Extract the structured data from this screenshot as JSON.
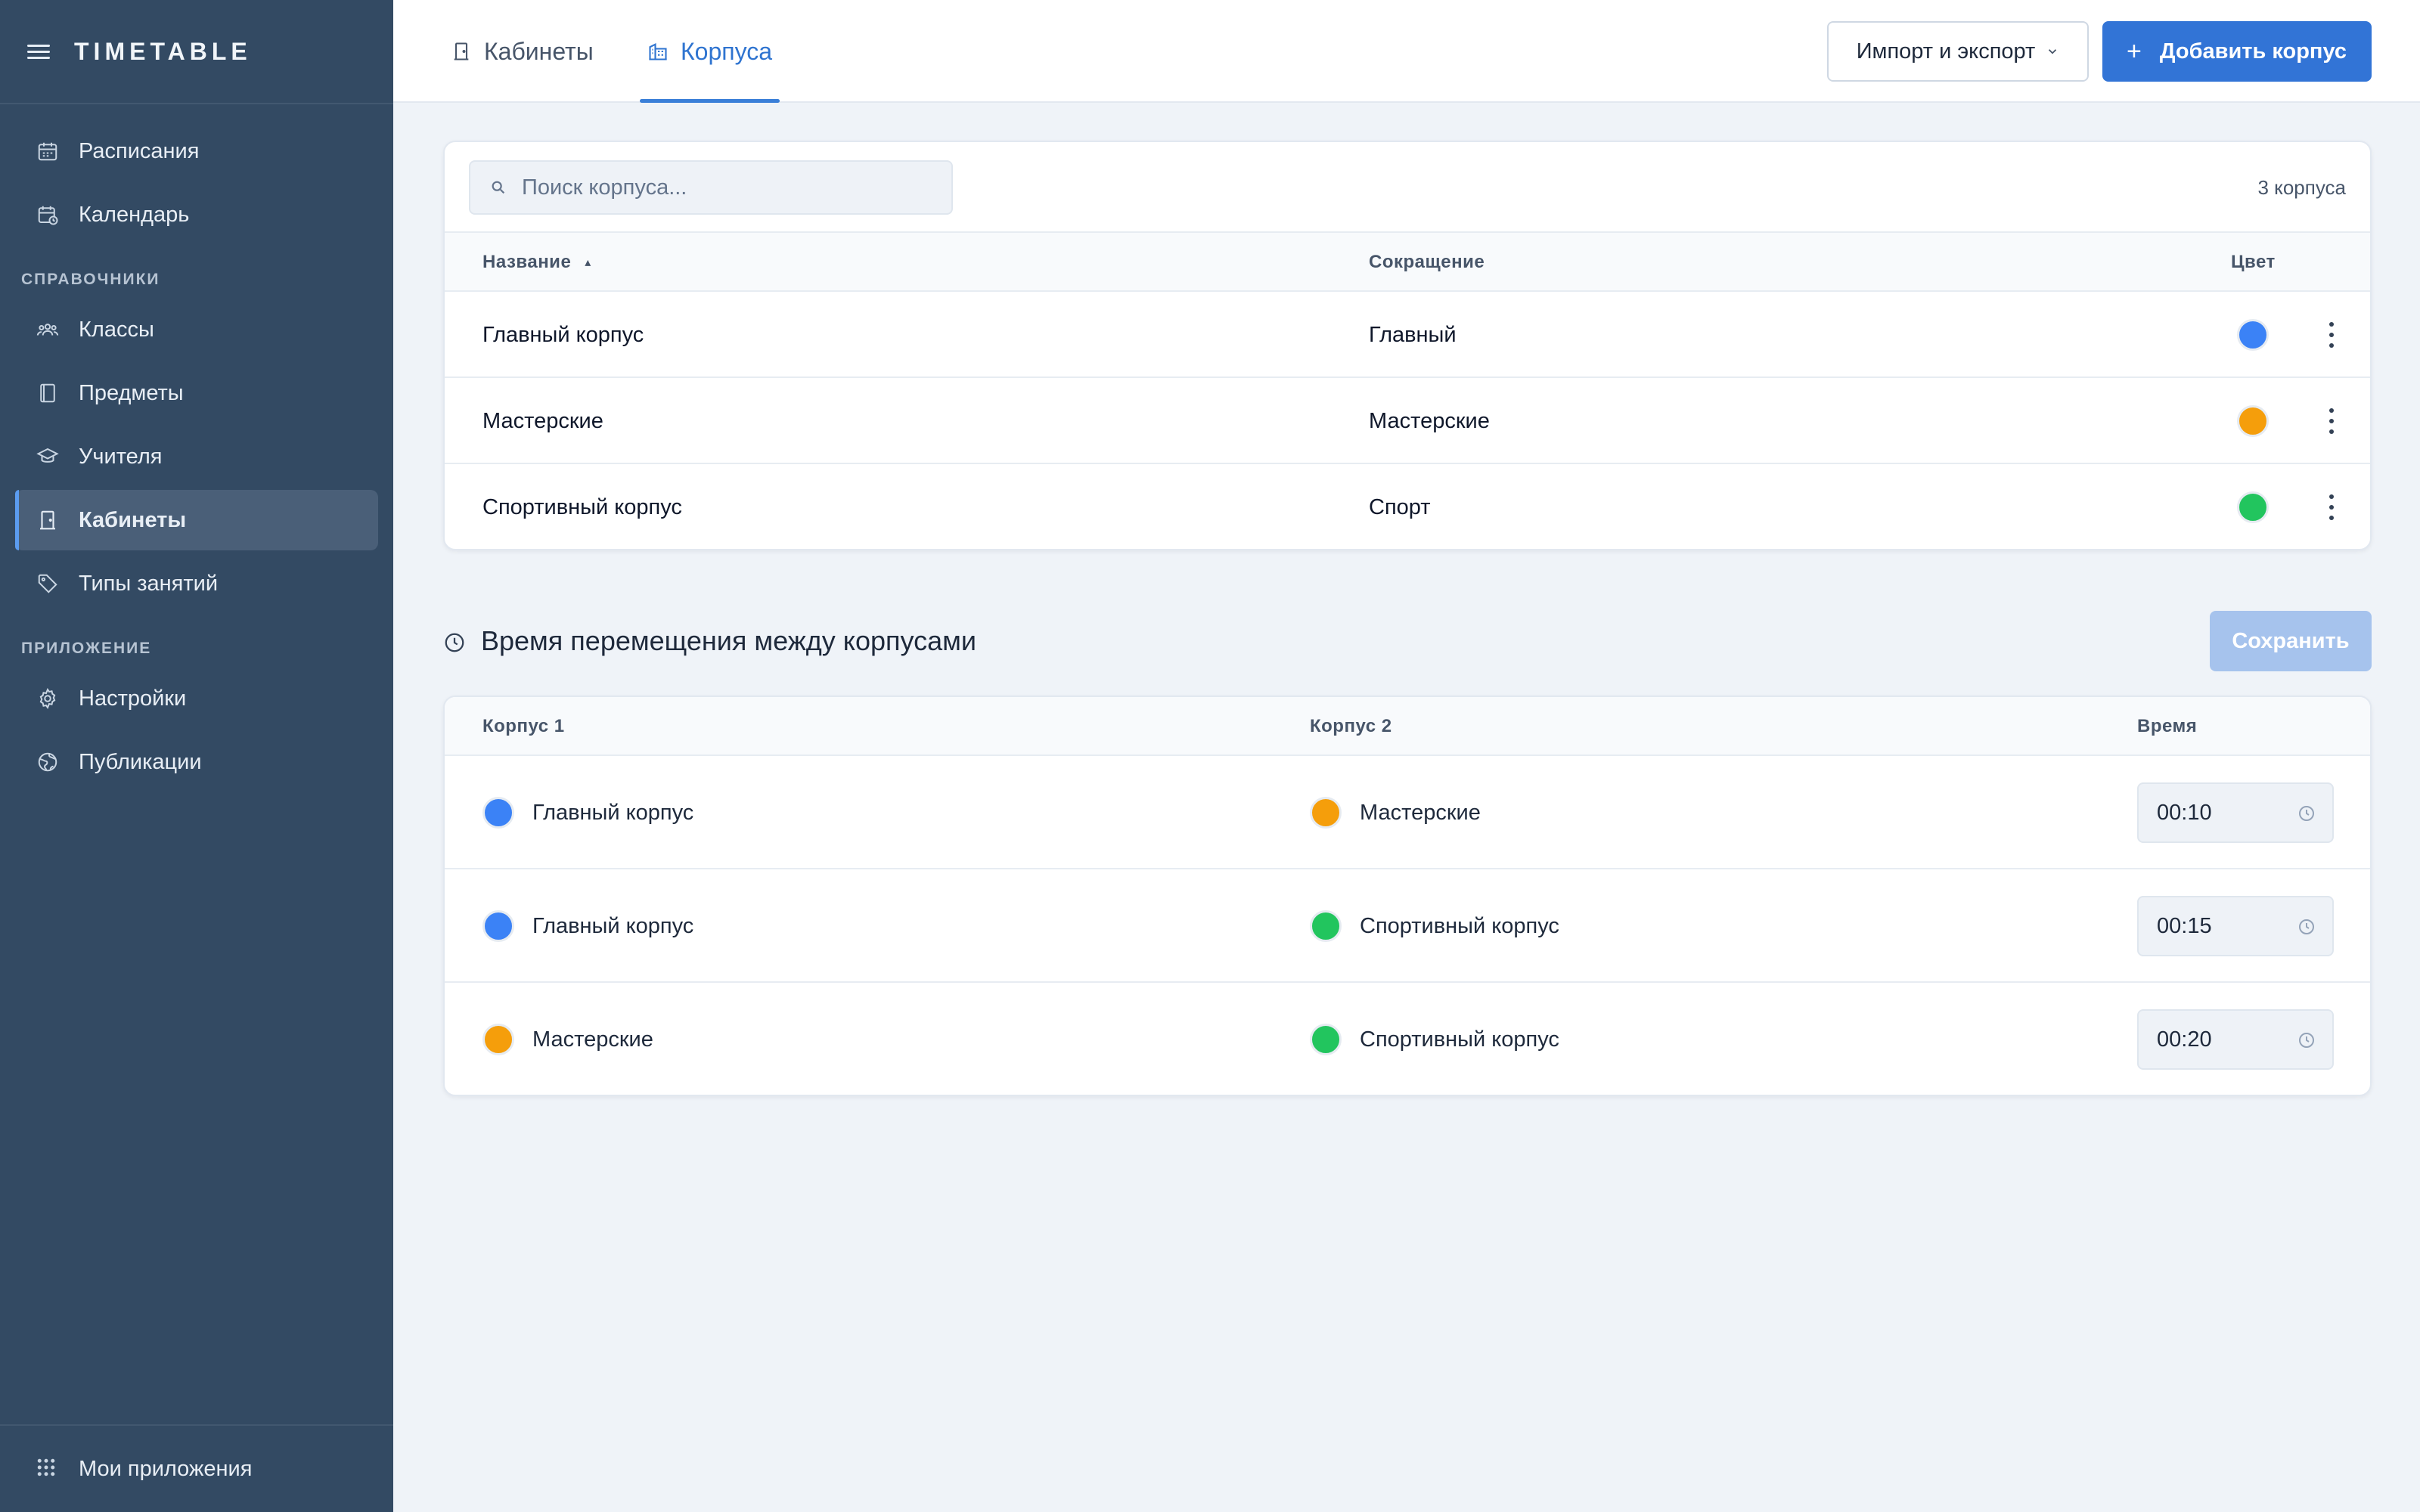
{
  "app": {
    "brand": "TIMETABLE"
  },
  "sidebar": {
    "top_items": [
      {
        "label": "Расписания",
        "icon": "calendar-icon"
      },
      {
        "label": "Календарь",
        "icon": "calendar-clock-icon"
      }
    ],
    "section_refs": "СПРАВОЧНИКИ",
    "ref_items": [
      {
        "label": "Классы",
        "icon": "group-icon"
      },
      {
        "label": "Предметы",
        "icon": "book-icon"
      },
      {
        "label": "Учителя",
        "icon": "graduation-cap-icon"
      },
      {
        "label": "Кабинеты",
        "icon": "door-icon",
        "active": true
      },
      {
        "label": "Типы занятий",
        "icon": "tag-icon"
      }
    ],
    "section_app": "ПРИЛОЖЕНИЕ",
    "app_items": [
      {
        "label": "Настройки",
        "icon": "gear-icon"
      },
      {
        "label": "Публикации",
        "icon": "globe-icon"
      }
    ],
    "footer": {
      "label": "Мои приложения",
      "icon": "apps-grid-icon"
    }
  },
  "topbar": {
    "tabs": [
      {
        "label": "Кабинеты",
        "icon": "door-icon",
        "active": false
      },
      {
        "label": "Корпуса",
        "icon": "buildings-icon",
        "active": true
      }
    ],
    "import_export_label": "Импорт и экспорт",
    "add_button_label": "Добавить корпус",
    "add_button_prefix": "+"
  },
  "buildings": {
    "search_placeholder": "Поиск корпуса...",
    "count": "3 корпуса",
    "columns": {
      "name": "Название",
      "short": "Сокращение",
      "color": "Цвет"
    },
    "sort_indicator": "▴",
    "rows": [
      {
        "name": "Главный корпус",
        "short": "Главный",
        "color": "#3b82f6"
      },
      {
        "name": "Мастерские",
        "short": "Мастерские",
        "color": "#f59e0b"
      },
      {
        "name": "Спортивный корпус",
        "short": "Спорт",
        "color": "#22c55e"
      }
    ]
  },
  "travel": {
    "title": "Время перемещения между корпусами",
    "save_label": "Сохранить",
    "columns": {
      "b1": "Корпус 1",
      "b2": "Корпус 2",
      "time": "Время"
    },
    "rows": [
      {
        "b1": "Главный корпус",
        "b1_color": "#3b82f6",
        "b2": "Мастерские",
        "b2_color": "#f59e0b",
        "time": "00:10"
      },
      {
        "b1": "Главный корпус",
        "b1_color": "#3b82f6",
        "b2": "Спортивный корпус",
        "b2_color": "#22c55e",
        "time": "00:15"
      },
      {
        "b1": "Мастерские",
        "b1_color": "#f59e0b",
        "b2": "Спортивный корпус",
        "b2_color": "#22c55e",
        "time": "00:20"
      }
    ]
  },
  "colors": {
    "sidebar_bg": "#334a63",
    "accent": "#3274d6",
    "save_disabled": "#a6c3ed"
  }
}
